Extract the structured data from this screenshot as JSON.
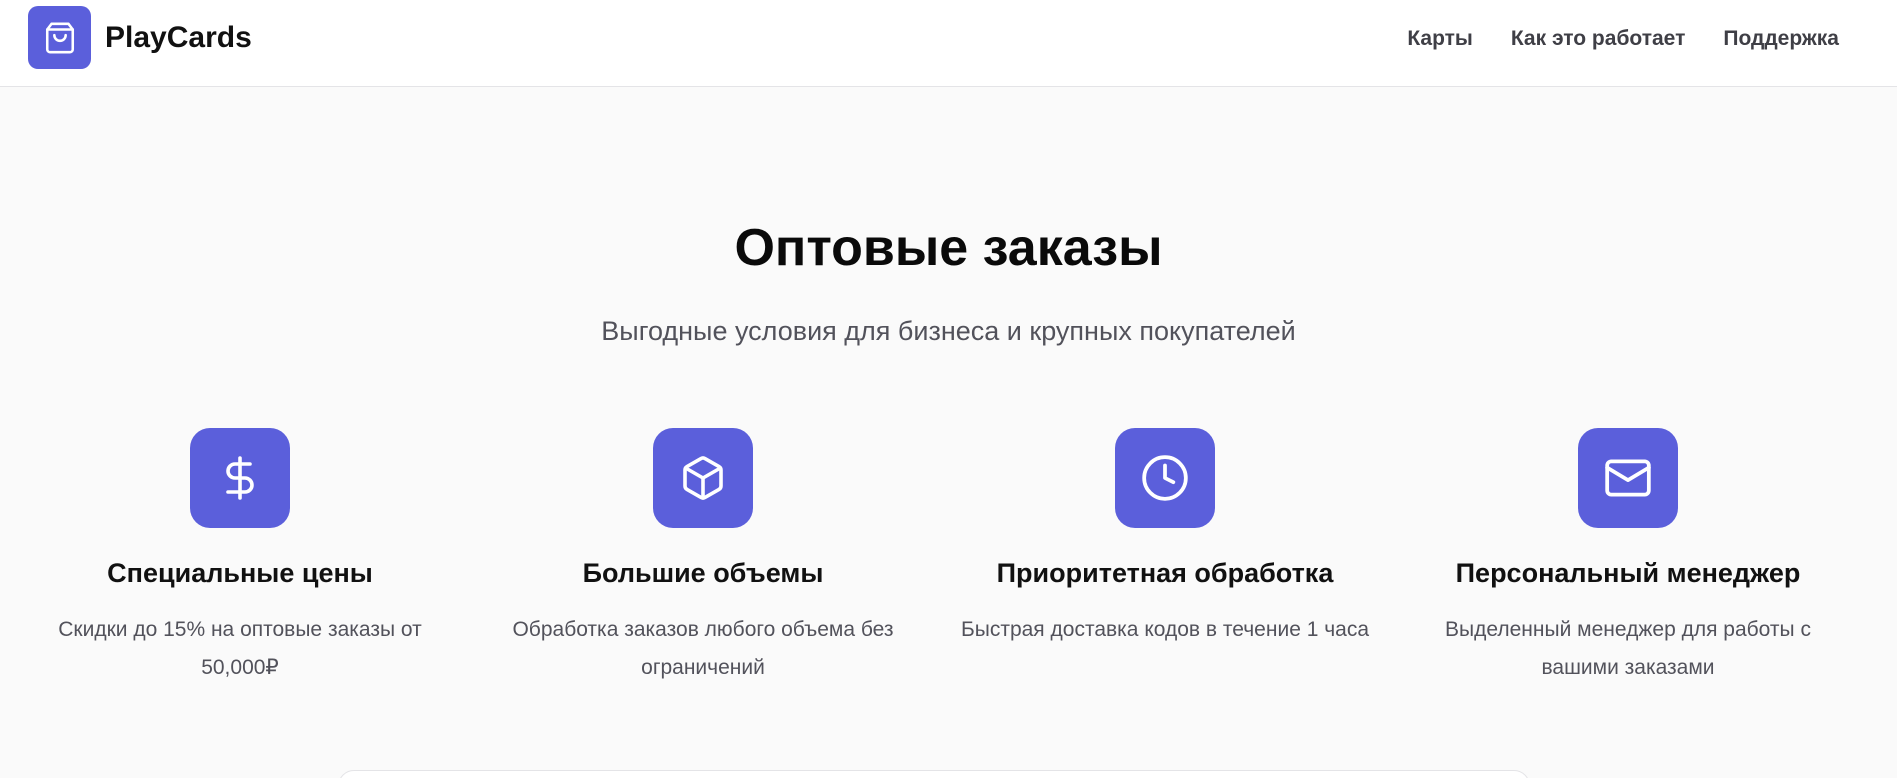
{
  "brand": {
    "name": "PlayCards",
    "icon": "shopping-bag-icon",
    "color": "#5b5fdb"
  },
  "nav": {
    "items": [
      {
        "label": "Карты"
      },
      {
        "label": "Как это работает"
      },
      {
        "label": "Поддержка"
      }
    ]
  },
  "hero": {
    "title": "Оптовые заказы",
    "subtitle": "Выгодные условия для бизнеса и крупных покупателей"
  },
  "features": [
    {
      "icon": "dollar-icon",
      "title": "Специальные цены",
      "desc": "Скидки до 15% на оптовые заказы от 50,000₽"
    },
    {
      "icon": "box-icon",
      "title": "Большие объемы",
      "desc": "Обработка заказов любого объема без ограничений"
    },
    {
      "icon": "clock-icon",
      "title": "Приоритетная обработка",
      "desc": "Быстрая доставка кодов в течение 1 часа"
    },
    {
      "icon": "mail-icon",
      "title": "Персональный менеджер",
      "desc": "Выделенный менеджер для работы с вашими заказами"
    }
  ]
}
